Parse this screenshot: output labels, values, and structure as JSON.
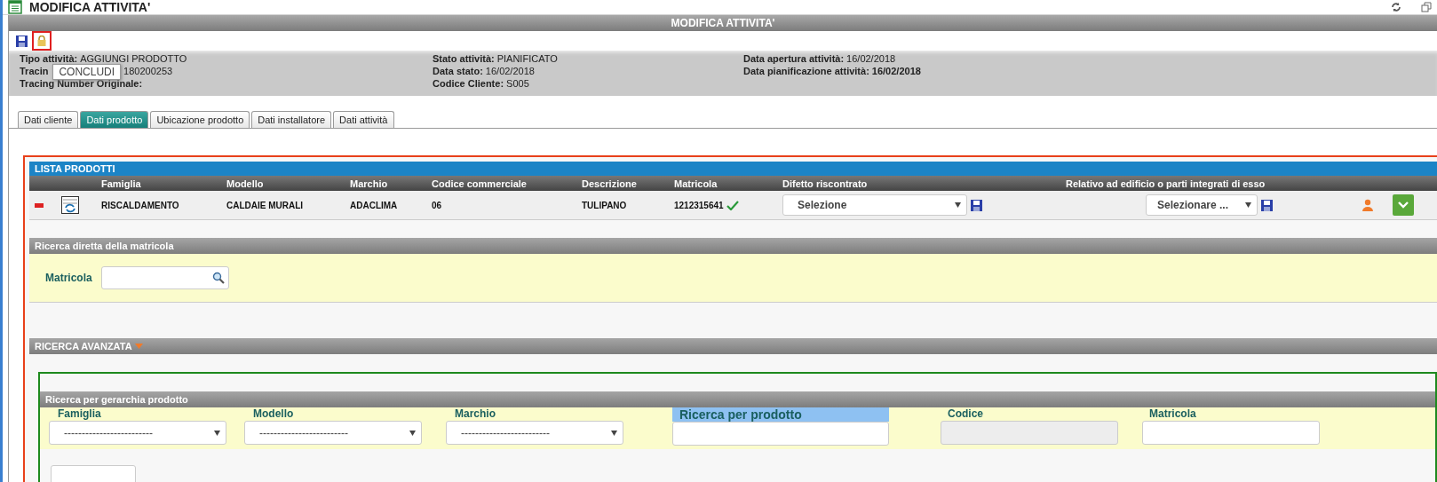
{
  "window": {
    "title": "MODIFICA ATTIVITA'"
  },
  "header": {
    "title": "MODIFICA ATTIVITA'"
  },
  "toolbar": {
    "tooltip": "CONCLUDI"
  },
  "info": [
    [
      {
        "label": "Tipo attività:",
        "value": "AGGIUNGI PRODOTTO"
      },
      {
        "label": "Tracin",
        "value": "180200253"
      },
      {
        "label": "Tracing Number Originale:"
      }
    ],
    [
      {
        "label": "Stato attività:",
        "value": "PIANIFICATO"
      },
      {
        "label": "Data stato:",
        "value": "16/02/2018"
      },
      {
        "label": "Codice Cliente:",
        "value": "S005"
      }
    ],
    [
      {
        "label": "Data apertura attività:",
        "value": "16/02/2018"
      },
      {
        "label": "Data pianificazione attività:",
        "value": "16/02/2018",
        "bold_value": true
      }
    ]
  ],
  "tabs": [
    {
      "label": "Dati cliente",
      "selected": false
    },
    {
      "label": "Dati prodotto",
      "selected": true
    },
    {
      "label": "Ubicazione prodotto",
      "selected": false
    },
    {
      "label": "Dati installatore",
      "selected": false
    },
    {
      "label": "Dati attività",
      "selected": false
    }
  ],
  "products": {
    "title": "LISTA PRODOTTI",
    "columns": [
      "Famiglia",
      "Modello",
      "Marchio",
      "Codice commerciale",
      "Descrizione",
      "Matricola",
      "Difetto riscontrato",
      "Relativo ad edificio o parti integrati di esso"
    ],
    "rows": [
      {
        "cells": [
          "RISCALDAMENTO",
          "CALDAIE MURALI",
          "ADACLIMA",
          "06",
          "TULIPANO",
          "1212315641"
        ],
        "verified": true,
        "defect": "Selezione",
        "building": "Selezionare ..."
      }
    ]
  },
  "direct_search": {
    "title": "Ricerca diretta della matricola",
    "label": "Matricola"
  },
  "advanced_search": {
    "title": "RICERCA AVANZATA",
    "hierarchy_title": "Ricerca per gerarchia prodotto",
    "fields": [
      {
        "kind": "select",
        "label": "Famiglia",
        "value": "-------------------------"
      },
      {
        "kind": "select",
        "label": "Modello",
        "value": "-------------------------"
      },
      {
        "kind": "select",
        "label": "Marchio",
        "value": "-------------------------"
      },
      {
        "kind": "highlight",
        "label": "Ricerca per prodotto"
      },
      {
        "kind": "disabled",
        "label": "Codice"
      },
      {
        "kind": "text",
        "label": "Matricola"
      }
    ]
  }
}
